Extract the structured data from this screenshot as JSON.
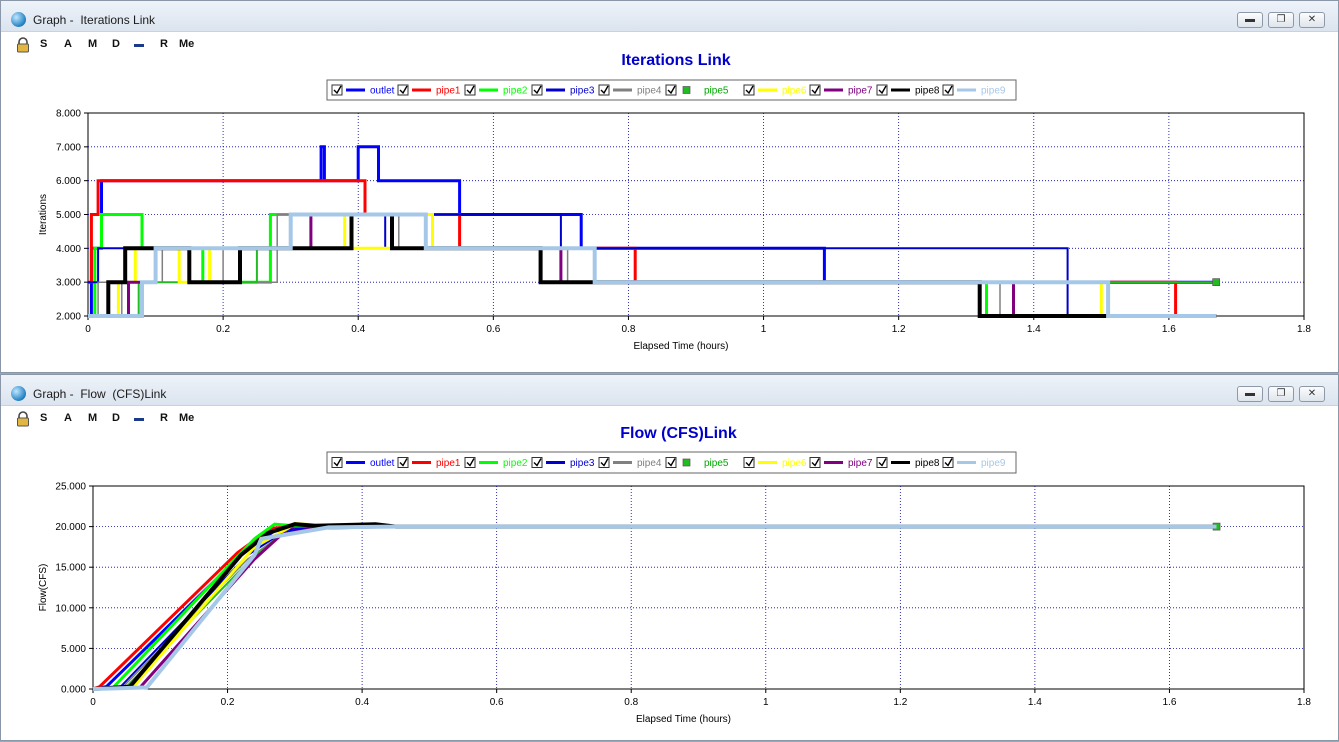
{
  "toolbar": {
    "items": [
      "S",
      "A",
      "M",
      "D",
      "R",
      "Me"
    ]
  },
  "series_styles": [
    {
      "name": "outlet",
      "color": "#0000ff",
      "label_color": "#0000ff"
    },
    {
      "name": "pipe1",
      "color": "#ff0000",
      "label_color": "#ff0000"
    },
    {
      "name": "pipe2",
      "color": "#00ff00",
      "label_color": "#00ff00"
    },
    {
      "name": "pipe3",
      "color": "#0000cc",
      "label_color": "#0000cc"
    },
    {
      "name": "pipe4",
      "color": "#808080",
      "label_color": "#808080"
    },
    {
      "name": "pipe5",
      "color": "#22bb22",
      "label_color": "#00aa00",
      "marker": "square"
    },
    {
      "name": "pipe6",
      "color": "#ffff00",
      "label_color": "#ffff00"
    },
    {
      "name": "pipe7",
      "color": "#800080",
      "label_color": "#800080"
    },
    {
      "name": "pipe8",
      "color": "#000000",
      "label_color": "#000000"
    },
    {
      "name": "pipe9",
      "color": "#a6c8e8",
      "label_color": "#a6c8e8"
    }
  ],
  "windows": {
    "iterations": {
      "title": "Graph -  Iterations Link"
    },
    "flow": {
      "title": "Graph -  Flow  (CFS)Link"
    }
  },
  "chart_data": [
    {
      "type": "line",
      "title": "Iterations Link",
      "xlabel": "Elapsed Time (hours)",
      "ylabel": "Iterations",
      "xlim": [
        0,
        1.8
      ],
      "ylim": [
        2,
        8
      ],
      "xticks": [
        0,
        0.2,
        0.4,
        0.6,
        0.8,
        1,
        1.2,
        1.4,
        1.6,
        1.8
      ],
      "xtick_labels": [
        "0",
        "0.2",
        "0.4",
        "0.6",
        "0.8",
        "1",
        "1.2",
        "1.4",
        "1.6",
        "1.8"
      ],
      "yticks": [
        2,
        3,
        4,
        5,
        6,
        7,
        8
      ],
      "ytick_labels": [
        "2.000",
        "3.000",
        "4.000",
        "5.000",
        "6.000",
        "7.000",
        "8.000"
      ],
      "grid": true,
      "legend": "top-center",
      "series": [
        {
          "name": "outlet",
          "step": true,
          "width": 3,
          "x": [
            0,
            0.005,
            0.02,
            0.34,
            0.345,
            0.35,
            0.4,
            0.43,
            0.55,
            0.73,
            1.09,
            1.48,
            1.67
          ],
          "y": [
            2,
            4,
            6,
            6,
            7,
            6,
            7,
            6,
            5,
            4,
            3,
            3,
            3
          ]
        },
        {
          "name": "pipe1",
          "step": true,
          "width": 3,
          "x": [
            0,
            0.005,
            0.015,
            0.08,
            0.26,
            0.39,
            0.41,
            0.55,
            0.75,
            0.81,
            1.48,
            1.61,
            1.67
          ],
          "y": [
            3,
            5,
            6,
            6,
            6,
            6,
            5,
            4,
            4,
            3,
            3,
            2,
            2
          ]
        },
        {
          "name": "pipe2",
          "step": true,
          "width": 3,
          "x": [
            0,
            0.01,
            0.02,
            0.045,
            0.06,
            0.08,
            0.09,
            0.12,
            0.17,
            0.19,
            0.27,
            0.3,
            0.5,
            0.67,
            0.7,
            0.75,
            1.33,
            1.36,
            1.67
          ],
          "y": [
            2,
            4,
            5,
            5,
            5,
            4,
            4,
            4,
            3,
            3,
            5,
            5,
            4,
            3,
            3,
            3,
            2,
            2,
            2
          ]
        },
        {
          "name": "pipe3",
          "step": true,
          "width": 2,
          "x": [
            0,
            0.015,
            0.08,
            0.14,
            0.22,
            0.44,
            0.7,
            1.45,
            1.67
          ],
          "y": [
            3,
            4,
            4,
            4,
            4,
            5,
            4,
            2,
            2
          ]
        },
        {
          "name": "pipe4",
          "step": true,
          "width": 1.5,
          "x": [
            0,
            0.015,
            0.025,
            0.05,
            0.075,
            0.11,
            0.2,
            0.28,
            0.46,
            0.71,
            1.35,
            1.67
          ],
          "y": [
            2,
            3,
            3,
            2,
            3,
            4,
            3,
            5,
            4,
            3,
            2,
            2
          ]
        },
        {
          "name": "pipe5",
          "step": true,
          "width": 2,
          "x": [
            0,
            0.075,
            0.17,
            0.25,
            0.3,
            0.5,
            0.75,
            1.67
          ],
          "y": [
            2,
            3,
            3,
            4,
            5,
            4,
            3,
            3
          ],
          "marker_last": true
        },
        {
          "name": "pipe6",
          "step": true,
          "width": 3,
          "x": [
            0,
            0.045,
            0.07,
            0.135,
            0.18,
            0.3,
            0.38,
            0.45,
            0.51,
            0.75,
            1.47,
            1.5,
            1.67
          ],
          "y": [
            2,
            3,
            4,
            3,
            4,
            5,
            4,
            5,
            4,
            3,
            3,
            2,
            2
          ]
        },
        {
          "name": "pipe7",
          "step": true,
          "width": 3,
          "x": [
            0,
            0.06,
            0.1,
            0.22,
            0.33,
            0.45,
            0.7,
            1.37,
            1.67
          ],
          "y": [
            2,
            3,
            4,
            4,
            5,
            4,
            3,
            2,
            2
          ]
        },
        {
          "name": "pipe8",
          "step": true,
          "width": 4,
          "x": [
            0,
            0.03,
            0.055,
            0.09,
            0.15,
            0.225,
            0.29,
            0.39,
            0.45,
            0.51,
            0.67,
            0.75,
            1.32,
            1.67
          ],
          "y": [
            2,
            3,
            4,
            4,
            3,
            4,
            4,
            5,
            4,
            4,
            3,
            3,
            2,
            2
          ]
        },
        {
          "name": "pipe9",
          "step": true,
          "width": 4,
          "x": [
            0,
            0.08,
            0.1,
            0.16,
            0.22,
            0.26,
            0.3,
            0.5,
            0.75,
            1.48,
            1.51,
            1.67
          ],
          "y": [
            2,
            3,
            4,
            4,
            4,
            4,
            5,
            4,
            3,
            3,
            2,
            2
          ]
        }
      ]
    },
    {
      "type": "line",
      "title": "Flow  (CFS)Link",
      "xlabel": "Elapsed Time (hours)",
      "ylabel": "Flow(CFS)",
      "xlim": [
        0,
        1.8
      ],
      "ylim": [
        0,
        25
      ],
      "xticks": [
        0,
        0.2,
        0.4,
        0.6,
        0.8,
        1,
        1.2,
        1.4,
        1.6,
        1.8
      ],
      "xtick_labels": [
        "0",
        "0.2",
        "0.4",
        "0.6",
        "0.8",
        "1",
        "1.2",
        "1.4",
        "1.6",
        "1.8"
      ],
      "yticks": [
        0,
        5,
        10,
        15,
        20,
        25
      ],
      "ytick_labels": [
        "0.000",
        "5.000",
        "10.000",
        "15.000",
        "20.000",
        "25.000"
      ],
      "grid": true,
      "legend": "top-center",
      "series": [
        {
          "name": "outlet",
          "width": 3,
          "x": [
            0,
            0.02,
            0.22,
            0.27,
            0.33,
            0.45,
            1.67
          ],
          "y": [
            0,
            0.3,
            16.5,
            19.5,
            20,
            20,
            20
          ]
        },
        {
          "name": "pipe1",
          "width": 3,
          "x": [
            0,
            0.01,
            0.215,
            0.265,
            0.32,
            0.42,
            1.67
          ],
          "y": [
            0,
            0.3,
            16.8,
            19.8,
            20.1,
            20,
            20
          ]
        },
        {
          "name": "pipe2",
          "width": 3,
          "x": [
            0,
            0.03,
            0.24,
            0.27,
            0.3,
            0.4,
            1.67
          ],
          "y": [
            0,
            0.2,
            18.5,
            20.3,
            20.1,
            20,
            20
          ]
        },
        {
          "name": "pipe3",
          "width": 2,
          "x": [
            0,
            0.04,
            0.23,
            0.28,
            0.32,
            0.45,
            1.67
          ],
          "y": [
            0,
            0.2,
            16.5,
            19.2,
            19.8,
            20,
            20
          ]
        },
        {
          "name": "pipe4",
          "width": 1.5,
          "x": [
            0,
            0.045,
            0.23,
            0.28,
            0.33,
            0.45,
            1.67
          ],
          "y": [
            0,
            0.3,
            16,
            19,
            19.8,
            20,
            20
          ]
        },
        {
          "name": "pipe5",
          "width": 2,
          "x": [
            0,
            0.05,
            0.235,
            0.28,
            0.33,
            0.45,
            1.67
          ],
          "y": [
            0,
            0.3,
            16,
            19,
            19.8,
            20,
            20
          ],
          "marker_last": true
        },
        {
          "name": "pipe6",
          "width": 3,
          "x": [
            0,
            0.06,
            0.24,
            0.29,
            0.3,
            0.36,
            1.67
          ],
          "y": [
            0,
            0.3,
            17.5,
            19.8,
            20.4,
            20,
            20
          ]
        },
        {
          "name": "pipe7",
          "width": 3,
          "x": [
            0,
            0.07,
            0.24,
            0.28,
            0.33,
            0.45,
            1.67
          ],
          "y": [
            0,
            0.2,
            16,
            19,
            19.8,
            20,
            20
          ]
        },
        {
          "name": "pipe8",
          "width": 4,
          "x": [
            0,
            0.055,
            0.22,
            0.26,
            0.3,
            0.33,
            0.42,
            0.45,
            1.67
          ],
          "y": [
            0,
            0.3,
            16.5,
            19.2,
            20.3,
            20.1,
            20.3,
            20,
            20
          ]
        },
        {
          "name": "pipe9",
          "width": 4,
          "x": [
            0,
            0.08,
            0.24,
            0.25,
            0.3,
            0.35,
            0.45,
            1.67
          ],
          "y": [
            0,
            0.2,
            16.5,
            18.5,
            19.2,
            19.9,
            20,
            20
          ]
        }
      ]
    }
  ]
}
